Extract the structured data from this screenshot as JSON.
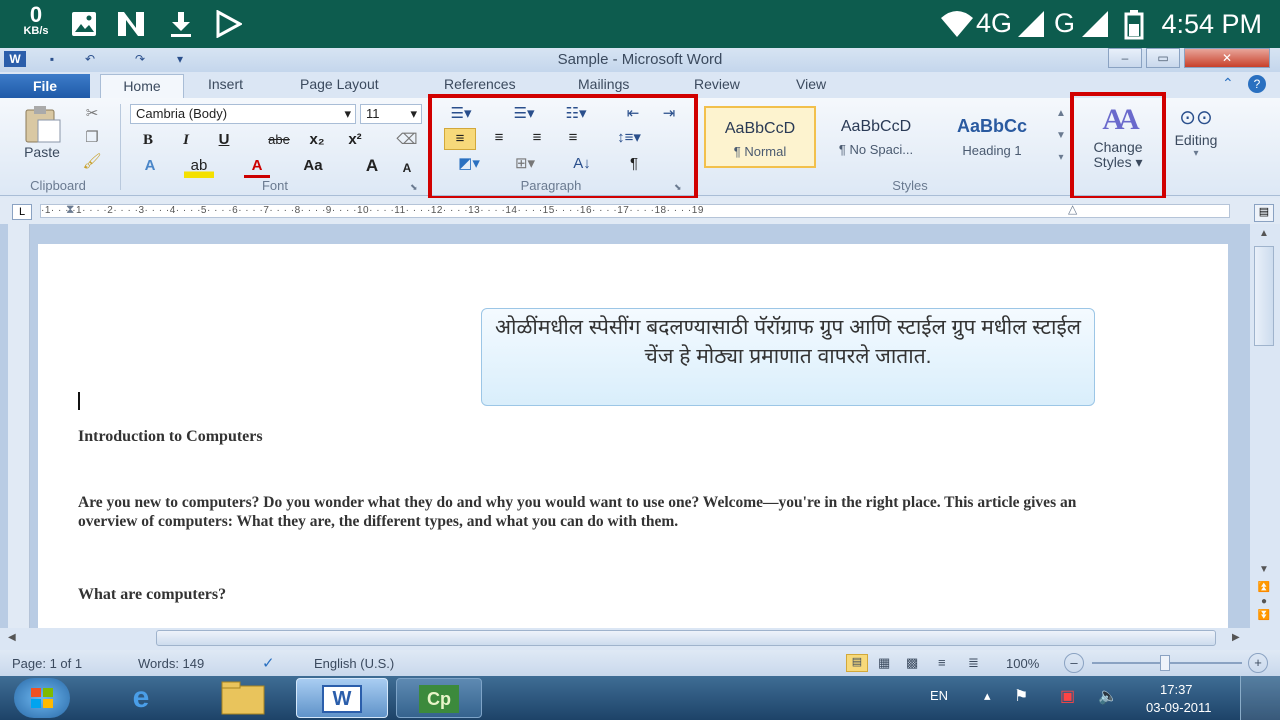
{
  "android_status": {
    "speed_value": "0",
    "speed_unit": "KB/s",
    "network_4g": "4G",
    "network_g": "G",
    "time": "4:54 PM",
    "icons": [
      "image-icon",
      "n-icon",
      "download-icon",
      "play-store-icon",
      "wifi-icon",
      "signal-icon",
      "battery-icon"
    ]
  },
  "word": {
    "window_title": "Sample - Microsoft Word",
    "tabs": {
      "file": "File",
      "home": "Home",
      "insert": "Insert",
      "page_layout": "Page Layout",
      "references": "References",
      "mailings": "Mailings",
      "review": "Review",
      "view": "View"
    },
    "clipboard": {
      "paste": "Paste",
      "group": "Clipboard"
    },
    "font": {
      "name": "Cambria (Body)",
      "size": "11",
      "group": "Font",
      "bold": "B",
      "italic": "I",
      "underline": "U",
      "strike": "abe",
      "subscript": "x₂",
      "superscript": "x²",
      "grow": "A",
      "shrink": "A",
      "change_case": "Aa"
    },
    "paragraph": {
      "group": "Paragraph",
      "pilcrow": "¶"
    },
    "styles": {
      "items": [
        {
          "preview": "AaBbCcD",
          "name": "¶ Normal"
        },
        {
          "preview": "AaBbCcD",
          "name": "¶ No Spaci..."
        },
        {
          "preview": "AaBbCc",
          "name": "Heading 1"
        }
      ],
      "group": "Styles",
      "change_styles_line1": "Change",
      "change_styles_line2": "Styles",
      "editing": "Editing"
    },
    "ruler_marks": "·1·  ·  ·  ·1·  ·  ·  ·2·  ·  ·  ·3·  ·  ·  ·4·  ·  ·  ·5·  ·  ·  ·6·  ·  ·  ·7·  ·  ·  ·8·  ·  ·  ·9·  ·  ·  ·10·  ·  ·  ·11·  ·  ·  ·12·  ·  ·  ·13·  ·  ·  ·14·  ·  ·  ·15·  ·  ·  ·16·  ·  ·  ·17·  ·  ·  ·18·  ·  ·  ·19",
    "document": {
      "callout": "ओळींमधील स्पेसींग बदलण्यासाठी पॅरॉग्राफ ग्रुप आणि स्टाईल ग्रुप मधील स्टाईल चेंज हे मोठ्या प्रमाणात वापरले जातात.",
      "heading1": "Introduction to Computers",
      "para1": "Are you new to computers? Do you wonder what they do and why you would want to use one? Welcome—you're in the right place. This article gives an overview of computers: What they are, the different types, and what you can do with them.",
      "heading2": "What are computers?"
    },
    "status": {
      "page": "Page: 1 of 1",
      "words": "Words: 149",
      "language": "English (U.S.)",
      "zoom": "100%"
    }
  },
  "taskbar": {
    "lang": "EN",
    "clock_time": "17:37",
    "clock_date": "03-09-2011",
    "apps": [
      "start-orb",
      "internet-explorer",
      "file-explorer",
      "word",
      "captivate"
    ]
  }
}
